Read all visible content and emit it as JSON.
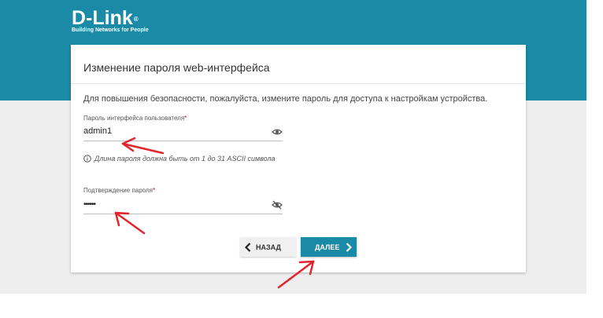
{
  "brand": {
    "name": "D-Link",
    "registered": "®",
    "tagline": "Building Networks for People"
  },
  "dialog": {
    "title": "Изменение пароля web-интерфейса",
    "description": "Для повышения безопасности, пожалуйста, измените пароль для доступа к настройкам устройства.",
    "password_label": "Пароль интерфейса пользователя",
    "password_value": "admin1",
    "required_mark": "*",
    "hint": "Длина пароля должна быть от 1 до 31 ASCII символа",
    "confirm_label": "Подтверждение пароля",
    "confirm_value": "••••••",
    "back_label": "НАЗАД",
    "next_label": "ДАЛЕЕ"
  },
  "colors": {
    "brand_teal": "#1a8aa6",
    "annotation_red": "#e3242b"
  },
  "icons": {
    "password_toggle": "eye-icon",
    "confirm_toggle": "eye-off-icon",
    "hint": "info-icon",
    "back": "chevron-left-icon",
    "next": "chevron-right-icon"
  }
}
